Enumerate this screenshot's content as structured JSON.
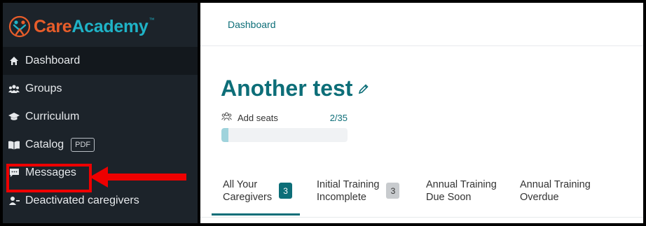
{
  "brand": {
    "care": "Care",
    "academy": "Academy",
    "tm": "™"
  },
  "sidebar": {
    "items": [
      {
        "label": "Dashboard",
        "icon": "home-icon"
      },
      {
        "label": "Groups",
        "icon": "users-icon"
      },
      {
        "label": "Curriculum",
        "icon": "graduation-cap-icon"
      },
      {
        "label": "Catalog",
        "icon": "book-icon",
        "badge": "PDF"
      },
      {
        "label": "Messages",
        "icon": "chat-icon"
      },
      {
        "label": "Deactivated caregivers",
        "icon": "user-minus-icon"
      }
    ]
  },
  "header": {
    "breadcrumb": "Dashboard"
  },
  "main": {
    "title": "Another test",
    "seats": {
      "label": "Add seats",
      "count": "2/35",
      "progress": 0.057
    },
    "tabs": [
      {
        "line1": "All Your",
        "line2": "Caregivers",
        "badge": "3"
      },
      {
        "line1": "Initial Training",
        "line2": "Incomplete",
        "badge": "3"
      },
      {
        "line1": "Annual Training",
        "line2": "Due Soon"
      },
      {
        "line1": "Annual Training",
        "line2": "Overdue"
      }
    ]
  },
  "colors": {
    "accent": "#0d6e78",
    "sidebar_bg": "#1c232a",
    "highlight": "#ee0000"
  }
}
